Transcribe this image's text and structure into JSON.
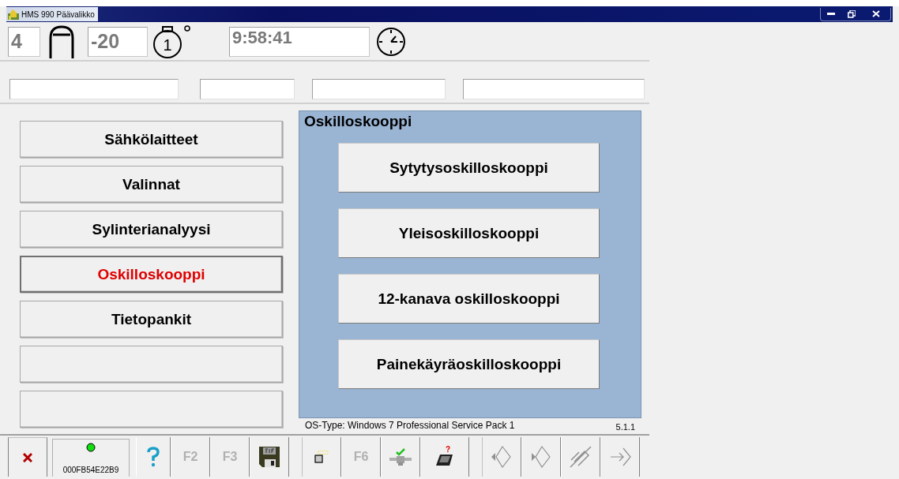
{
  "window": {
    "title": "HMS 990 Päävalikko"
  },
  "readouts": {
    "cylinder": "4",
    "temperature": "-20",
    "time": "9:58:41",
    "stopwatch_number": "1"
  },
  "menu": [
    {
      "label": "Sähkölaitteet",
      "selected": false
    },
    {
      "label": "Valinnat",
      "selected": false
    },
    {
      "label": "Sylinterianalyysi",
      "selected": false
    },
    {
      "label": "Oskilloskooppi",
      "selected": true
    },
    {
      "label": "Tietopankit",
      "selected": false
    },
    {
      "selected": false
    },
    {
      "selected": false
    }
  ],
  "panel": {
    "title": "Oskilloskooppi",
    "buttons": [
      "Sytytysoskilloskooppi",
      "Yleisoskilloskooppi",
      "12-kanava oskilloskooppi",
      "Painekäyräoskilloskooppi"
    ]
  },
  "status": {
    "os": "OS-Type: Windows 7 Professional Service Pack 1",
    "version": "5.1.1"
  },
  "toolbar": [
    {
      "kind": "close"
    },
    {
      "kind": "status",
      "label": "000FB54E22B9",
      "on": true
    },
    {
      "kind": "help"
    },
    {
      "kind": "text",
      "label": "F2",
      "disabled": true
    },
    {
      "kind": "text",
      "label": "F3",
      "disabled": true
    },
    {
      "kind": "gif"
    },
    {
      "kind": "square",
      "gap": true
    },
    {
      "kind": "text",
      "label": "F6",
      "disabled": true
    },
    {
      "kind": "network"
    },
    {
      "kind": "device",
      "badge": "?"
    },
    {
      "kind": "left",
      "gap": true
    },
    {
      "kind": "right"
    },
    {
      "kind": "diag"
    },
    {
      "kind": "enter"
    }
  ]
}
